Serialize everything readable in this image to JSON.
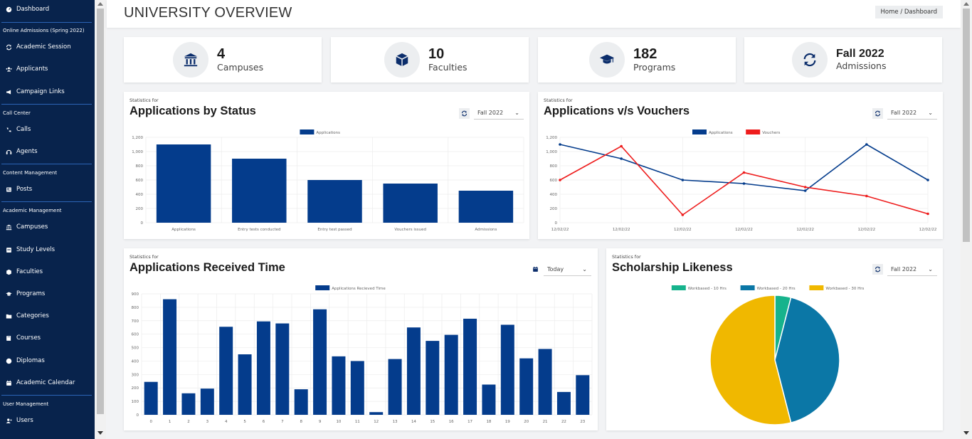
{
  "sidebar": {
    "top_item": {
      "label": "Dashboard",
      "icon": "dashboard-icon"
    },
    "sections": [
      {
        "heading": "Online Admissions (Spring 2022)",
        "items": [
          {
            "label": "Academic Session",
            "icon": "sync-icon"
          },
          {
            "label": "Applicants",
            "icon": "users-icon"
          },
          {
            "label": "Campaign Links",
            "icon": "megaphone-icon"
          }
        ]
      },
      {
        "heading": "Call Center",
        "items": [
          {
            "label": "Calls",
            "icon": "phone-volume-icon"
          },
          {
            "label": "Agents",
            "icon": "headset-icon"
          }
        ]
      },
      {
        "heading": "Content Management",
        "items": [
          {
            "label": "Posts",
            "icon": "newspaper-icon"
          }
        ]
      },
      {
        "heading": "Academic Management",
        "items": [
          {
            "label": "Campuses",
            "icon": "university-icon"
          },
          {
            "label": "Study Levels",
            "icon": "layers-icon"
          },
          {
            "label": "Faculties",
            "icon": "box-icon"
          },
          {
            "label": "Programs",
            "icon": "graduation-cap-icon"
          },
          {
            "label": "Categories",
            "icon": "folder-icon"
          },
          {
            "label": "Courses",
            "icon": "book-icon"
          },
          {
            "label": "Diplomas",
            "icon": "award-icon"
          },
          {
            "label": "Academic Calendar",
            "icon": "calendar-icon"
          }
        ]
      },
      {
        "heading": "User Management",
        "items": [
          {
            "label": "Users",
            "icon": "user-icon"
          }
        ]
      }
    ]
  },
  "header": {
    "title": "UNIVERSITY OVERVIEW",
    "breadcrumb": "Home / Dashboard"
  },
  "stats": [
    {
      "value": "4",
      "label": "Campuses",
      "icon": "university-icon"
    },
    {
      "value": "10",
      "label": "Faculties",
      "icon": "cube-icon"
    },
    {
      "value": "182",
      "label": "Programs",
      "icon": "graduation-cap-icon"
    },
    {
      "value": "Fall 2022",
      "label": "Admissions",
      "icon": "sync-icon"
    }
  ],
  "cards": {
    "status": {
      "statistics_for": "Statistics for",
      "title": "Applications by Status",
      "select": "Fall 2022"
    },
    "vouchers": {
      "statistics_for": "Statistics for",
      "title": "Applications v/s Vouchers",
      "select": "Fall 2022"
    },
    "received": {
      "statistics_for": "Statistics for",
      "title": "Applications Received Time",
      "select": "Today"
    },
    "scholarship": {
      "statistics_for": "Statistics for",
      "title": "Scholarship Likeness",
      "select": "Fall 2022"
    }
  },
  "colors": {
    "sidebar": "#08234c",
    "primary": "#043c8c",
    "red": "#ee1c1c",
    "teal": "#16b38c",
    "blue": "#0b77a6",
    "yellow": "#f0b800"
  },
  "chart_data": [
    {
      "type": "bar",
      "categories": [
        "Applications",
        "Entry tests conducted",
        "Entry test passed",
        "Vouchers issued",
        "Admissions"
      ],
      "series": [
        {
          "name": "Applications",
          "values": [
            1100,
            900,
            600,
            550,
            450
          ]
        }
      ],
      "ylim": [
        0,
        1200
      ],
      "yticks": [
        "0",
        "200",
        "400",
        "600",
        "800",
        "1,000",
        "1,200"
      ],
      "legend": "top-center"
    },
    {
      "type": "line",
      "categories": [
        "12/02/22",
        "12/02/22",
        "12/02/22",
        "12/02/22",
        "12/02/22",
        "12/02/22",
        "12/02/22"
      ],
      "series": [
        {
          "name": "Applications",
          "values": [
            1100,
            900,
            600,
            550,
            450,
            1100,
            600
          ]
        },
        {
          "name": "Vouchers",
          "values": [
            600,
            1075,
            110,
            705,
            500,
            375,
            125
          ]
        }
      ],
      "ylim": [
        0,
        1200
      ],
      "yticks": [
        "0",
        "200",
        "400",
        "600",
        "800",
        "1,000",
        "1,200"
      ],
      "legend": "top-center"
    },
    {
      "type": "bar",
      "categories": [
        "0",
        "1",
        "2",
        "3",
        "4",
        "5",
        "6",
        "7",
        "8",
        "9",
        "10",
        "11",
        "12",
        "13",
        "14",
        "15",
        "16",
        "17",
        "18",
        "19",
        "20",
        "21",
        "22",
        "23"
      ],
      "series": [
        {
          "name": "Applications Recieved Time",
          "values": [
            245,
            860,
            160,
            195,
            655,
            450,
            695,
            680,
            190,
            785,
            435,
            400,
            20,
            415,
            650,
            550,
            595,
            715,
            225,
            670,
            420,
            490,
            170,
            295
          ]
        }
      ],
      "ylim": [
        0,
        900
      ],
      "yticks": [
        "0",
        "100",
        "200",
        "300",
        "400",
        "500",
        "600",
        "700",
        "800",
        "900"
      ],
      "legend": "top-center"
    },
    {
      "type": "pie",
      "series": [
        {
          "name": "Workbased - 10 Hrs",
          "value": 4
        },
        {
          "name": "Workbased - 20 Hrs",
          "value": 42
        },
        {
          "name": "Workbased - 30 Hrs",
          "value": 54
        }
      ],
      "legend": "top-center"
    }
  ]
}
